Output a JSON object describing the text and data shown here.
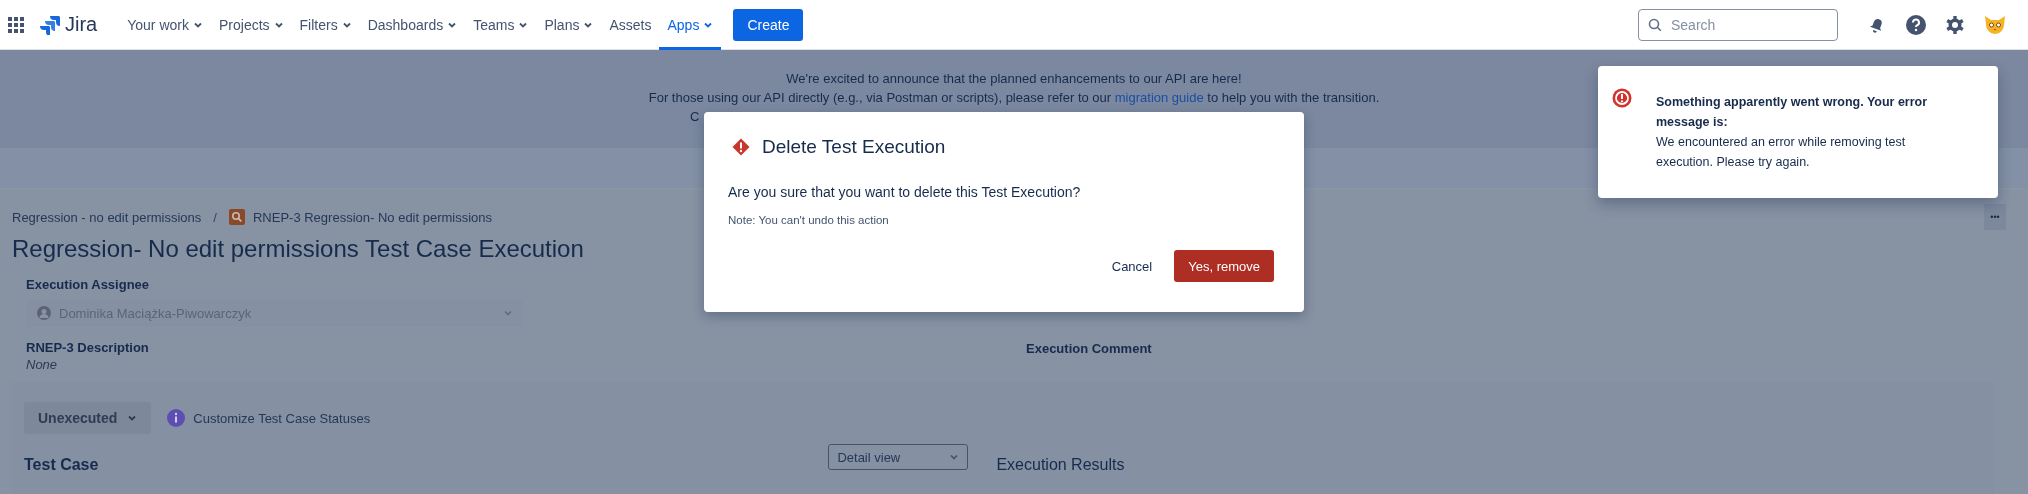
{
  "nav": {
    "logo": "Jira",
    "items": [
      {
        "label": "Your work",
        "dropdown": true,
        "selected": false
      },
      {
        "label": "Projects",
        "dropdown": true,
        "selected": false
      },
      {
        "label": "Filters",
        "dropdown": true,
        "selected": false
      },
      {
        "label": "Dashboards",
        "dropdown": true,
        "selected": false
      },
      {
        "label": "Teams",
        "dropdown": true,
        "selected": false
      },
      {
        "label": "Plans",
        "dropdown": true,
        "selected": false
      },
      {
        "label": "Assets",
        "dropdown": false,
        "selected": false
      },
      {
        "label": "Apps",
        "dropdown": true,
        "selected": true
      }
    ],
    "create": "Create",
    "search": {
      "placeholder": "Search"
    }
  },
  "banner": {
    "line1": "We're excited to announce that the planned enhancements to our API are here!",
    "line2_before": "For those using our API directly (e.g., via Postman or scripts), please refer to our",
    "link": "migration guide",
    "line2_after": "to help you with the transition.",
    "line3": "C"
  },
  "breadcrumb_separator": "/",
  "more_button": "•••",
  "breadcrumbs": [
    {
      "label": "Regression - no edit permissions"
    },
    {
      "label": "RNEP-3 Regression- No edit permissions"
    }
  ],
  "title": "Regression- No edit permissions Test Case Execution",
  "assignee": {
    "label": "Execution Assignee",
    "value": "Dominika Maciążka-Piwowarczyk"
  },
  "description": {
    "label": "RNEP-3 Description",
    "value": "None"
  },
  "comment": {
    "label": "Execution Comment"
  },
  "status_button": "Unexecuted",
  "customize": "Customize Test Case Statuses",
  "test_case": "Test Case",
  "view_select": "Detail view",
  "results": "Execution Results",
  "dialog": {
    "title": "Delete Test Execution",
    "message": "Are you sure that you want to delete this Test Execution?",
    "note": "Note: You can't undo this action",
    "cancel": "Cancel",
    "confirm": "Yes, remove"
  },
  "toast": {
    "title": "Something apparently went wrong. Your error message is:",
    "message": "We encountered an error while removing test execution. Please try again."
  }
}
